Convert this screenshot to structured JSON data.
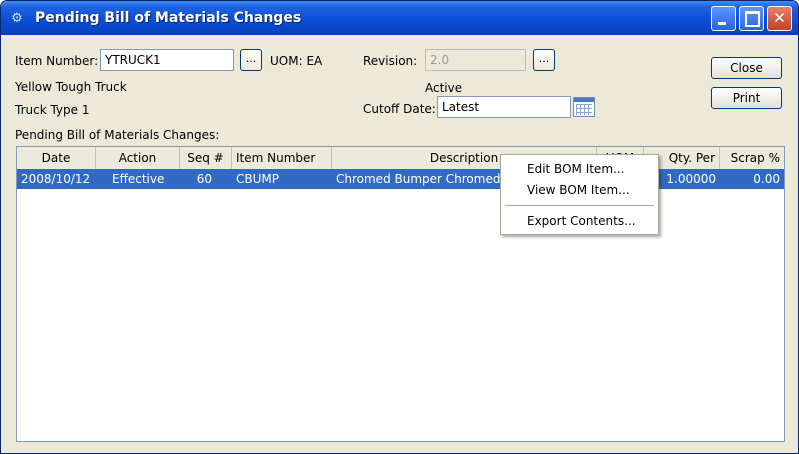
{
  "window": {
    "title": "Pending Bill of Materials Changes",
    "title_icon": "bom-icon",
    "controls": [
      "minimize",
      "maximize",
      "close"
    ],
    "close_glyph": "✕"
  },
  "form": {
    "item_number_label": "Item Number:",
    "item_number_value": "YTRUCK1",
    "item_lookup_label": "...",
    "uom_label": "UOM: EA",
    "revision_label": "Revision:",
    "revision_value": "2.0",
    "revision_lookup_label": "...",
    "item_description1": "Yellow Tough Truck",
    "item_description2": "Truck Type 1",
    "revision_status": "Active",
    "cutoff_label": "Cutoff Date:",
    "cutoff_value": "Latest"
  },
  "buttons": {
    "close": "Close",
    "print": "Print"
  },
  "list": {
    "label": "Pending Bill of Materials Changes:",
    "columns": [
      "Date",
      "Action",
      "Seq #",
      "Item Number",
      "Description",
      "UOM",
      "Qty. Per",
      "Scrap %"
    ],
    "rows": [
      {
        "date": "2008/10/12",
        "action": "Effective",
        "seq": "60",
        "item_number": "CBUMP",
        "description": "Chromed Bumper Chromed T",
        "uom": "",
        "qty_per": "1.00000",
        "scrap": "0.00"
      }
    ],
    "selection_color": "#316ac5"
  },
  "context_menu": {
    "items": [
      "Edit BOM Item...",
      "View BOM Item...",
      "Export Contents..."
    ]
  }
}
